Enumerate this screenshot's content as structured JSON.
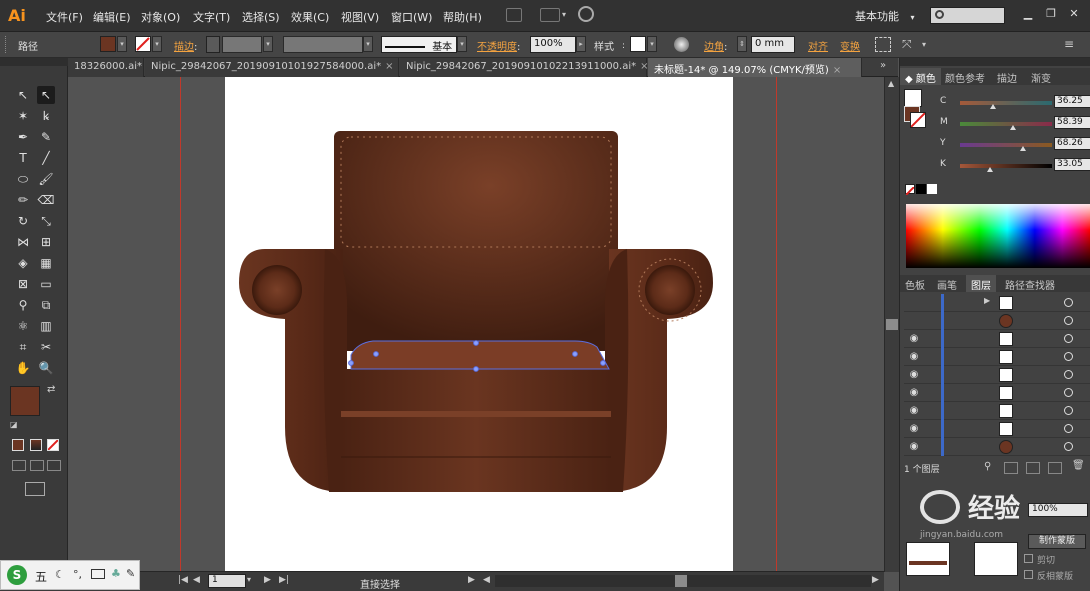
{
  "menubar": {
    "logo": "Ai",
    "items": [
      "文件(F)",
      "编辑(E)",
      "对象(O)",
      "文字(T)",
      "选择(S)",
      "效果(C)",
      "视图(V)",
      "窗口(W)",
      "帮助(H)"
    ],
    "workspace": "基本功能",
    "workspace_arrow": "▾"
  },
  "control": {
    "path_label": "路径",
    "stroke_label": "描边",
    "stroke_style": "基本",
    "opacity_label": "不透明度",
    "opacity_value": "100%",
    "style_label": "样式",
    "corner_label": "边角",
    "corner_value": "0 mm",
    "align_label": "对齐",
    "transform_label": "变换",
    "fill_color": "#6b3522",
    "accent_color": "#f4a340"
  },
  "tabs": [
    {
      "label": "18326000.ai*",
      "close": "×"
    },
    {
      "label": "Nipic_29842067_20190910101927584000.ai*",
      "close": "×"
    },
    {
      "label": "Nipic_29842067_20190910102213911000.ai*",
      "close": "×"
    },
    {
      "label": "未标题-14* @ 149.07% (CMYK/预览)",
      "close": "×"
    }
  ],
  "status": {
    "zoom": "",
    "page": "1",
    "tool_label": "直接选择"
  },
  "color_panel": {
    "tabs": [
      "颜色",
      "颜色参考",
      "描边",
      "渐变"
    ],
    "channels": [
      {
        "letter": "C",
        "value": "36.25",
        "pos": 0.36,
        "color_from": "#00b4e0",
        "color_to": "#6b2a18"
      },
      {
        "letter": "M",
        "value": "58.39",
        "pos": 0.58,
        "color_from": "#4a9a3a",
        "color_to": "#8a2a4a"
      },
      {
        "letter": "Y",
        "value": "68.26",
        "pos": 0.68,
        "color_from": "#6a3a90",
        "color_to": "#8a5a20"
      },
      {
        "letter": "K",
        "value": "33.05",
        "pos": 0.33,
        "color_from": "#a4573a",
        "color_to": "#000000"
      }
    ],
    "swatch": "#6b3522"
  },
  "layers_panel": {
    "tabs": [
      "色板",
      "画笔",
      "图层",
      "路径查找器"
    ],
    "rows": [
      {
        "thumb": "#ffffff",
        "eye": "",
        "arrow": "▶"
      },
      {
        "thumb": "#6b3522",
        "eye": "",
        "arrow": ""
      },
      {
        "thumb": "#ffffff",
        "eye": "◉",
        "arrow": ""
      },
      {
        "thumb": "#ffffff",
        "eye": "◉",
        "arrow": ""
      },
      {
        "thumb": "#ffffff",
        "eye": "◉",
        "arrow": ""
      },
      {
        "thumb": "#ffffff",
        "eye": "◉",
        "arrow": ""
      },
      {
        "thumb": "#ffffff",
        "eye": "◉",
        "arrow": ""
      },
      {
        "thumb": "#ffffff",
        "eye": "◉",
        "arrow": ""
      },
      {
        "thumb": "#6b3522",
        "eye": "◉",
        "arrow": ""
      }
    ],
    "count_label": "1 个图层",
    "opacity_value": "100%",
    "mask_button": "制作蒙版",
    "clip_label": "剪切",
    "invert_label": "反相蒙版"
  },
  "watermark": {
    "text": "经验",
    "sub": "jingyan.baidu.com"
  },
  "ime": {
    "label": "五"
  }
}
